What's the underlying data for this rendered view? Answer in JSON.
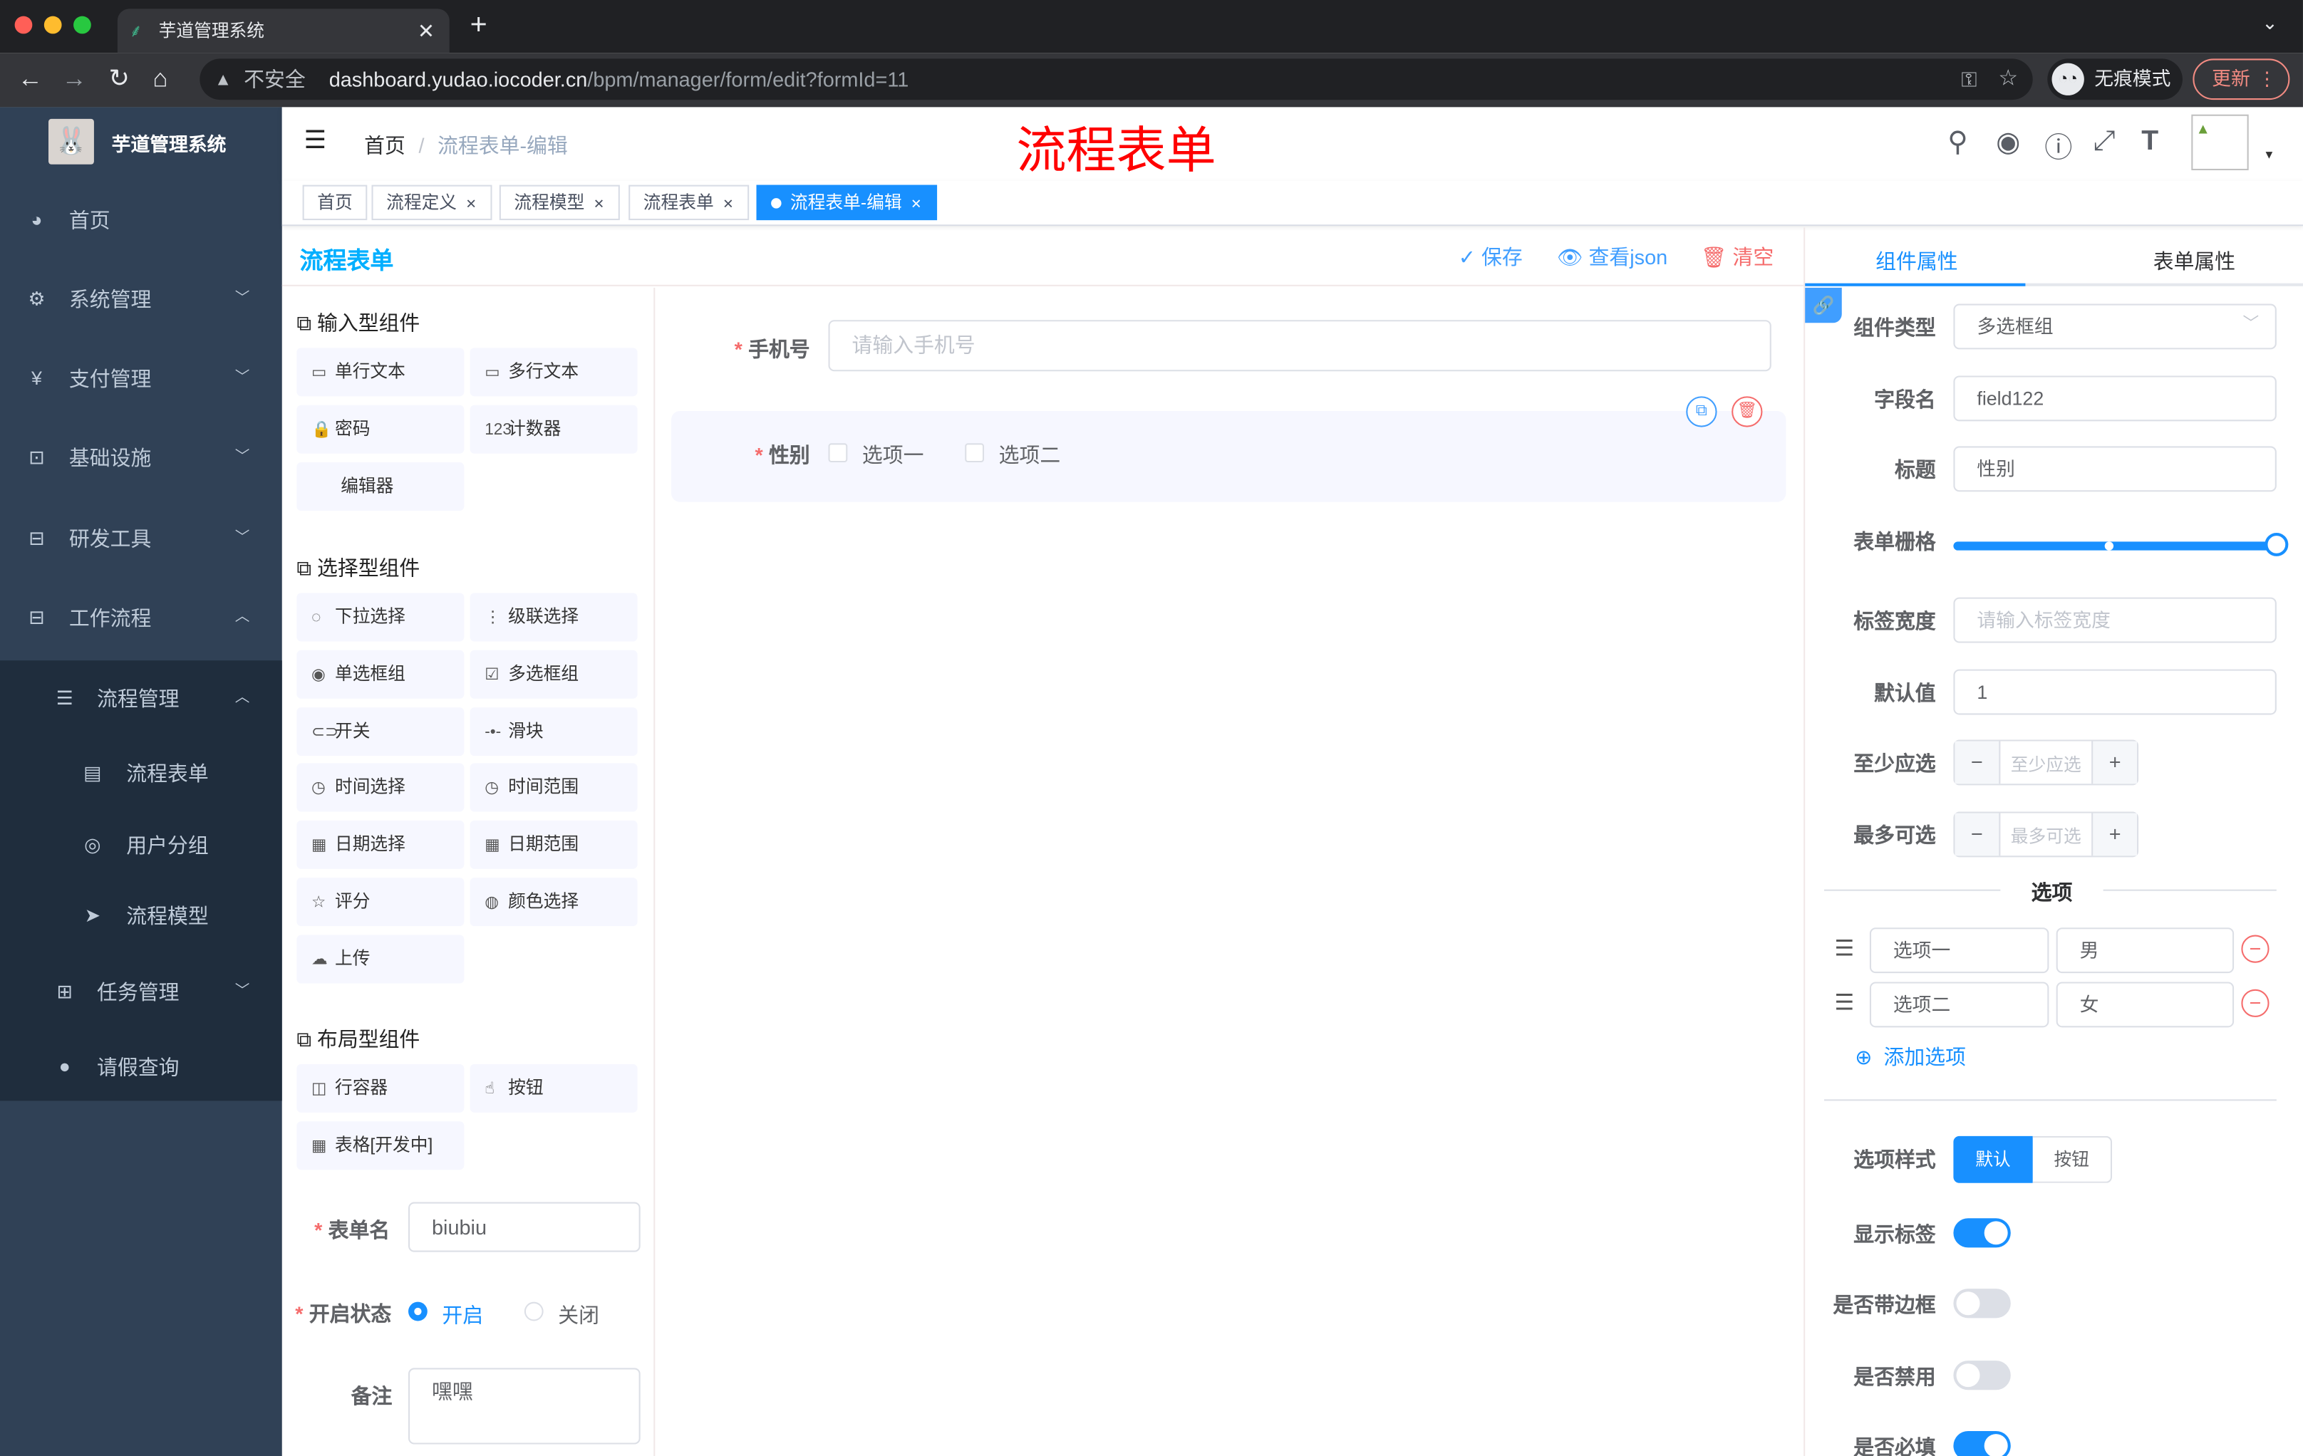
{
  "browser": {
    "tab_title": "芋道管理系统",
    "security": "不安全",
    "url_host": "dashboard.yudao.iocoder.cn",
    "url_path": "/bpm/manager/form/edit?formId=11",
    "incognito": "无痕模式",
    "update": "更新"
  },
  "sidebar": {
    "title": "芋道管理系统",
    "items": [
      {
        "label": "首页",
        "icon": "dashboard-icon"
      },
      {
        "label": "系统管理",
        "icon": "gear-icon"
      },
      {
        "label": "支付管理",
        "icon": "yen-icon"
      },
      {
        "label": "基础设施",
        "icon": "monitor-icon"
      },
      {
        "label": "研发工具",
        "icon": "toolbox-icon"
      },
      {
        "label": "工作流程",
        "icon": "toolbox-icon"
      },
      {
        "label": "流程管理",
        "icon": "list-icon"
      },
      {
        "label": "流程表单",
        "icon": "form-icon"
      },
      {
        "label": "用户分组",
        "icon": "group-icon"
      },
      {
        "label": "流程模型",
        "icon": "send-icon"
      },
      {
        "label": "任务管理",
        "icon": "tree-icon"
      },
      {
        "label": "请假查询",
        "icon": "user-icon"
      }
    ]
  },
  "navbar": {
    "breadcrumb": [
      "首页",
      "流程表单-编辑"
    ],
    "overlay_title": "流程表单"
  },
  "tags": [
    {
      "label": "首页"
    },
    {
      "label": "流程定义"
    },
    {
      "label": "流程模型"
    },
    {
      "label": "流程表单"
    },
    {
      "label": "流程表单-编辑"
    }
  ],
  "editor": {
    "title": "流程表单",
    "save": "保存",
    "view_json": "查看json",
    "clear": "清空"
  },
  "components": {
    "input_section": "输入型组件",
    "input": [
      {
        "label": "单行文本",
        "icon": "▭"
      },
      {
        "label": "多行文本",
        "icon": "▭"
      },
      {
        "label": "密码",
        "icon": "🔒"
      },
      {
        "label": "计数器",
        "icon": "123"
      },
      {
        "label": "编辑器",
        "icon": ""
      }
    ],
    "select_section": "选择型组件",
    "select": [
      {
        "label": "下拉选择",
        "icon": "◌"
      },
      {
        "label": "级联选择",
        "icon": "⋮"
      },
      {
        "label": "单选框组",
        "icon": "◉"
      },
      {
        "label": "多选框组",
        "icon": "☑"
      },
      {
        "label": "开关",
        "icon": "⊂⊃"
      },
      {
        "label": "滑块",
        "icon": "-•-"
      },
      {
        "label": "时间选择",
        "icon": "◷"
      },
      {
        "label": "时间范围",
        "icon": "◷"
      },
      {
        "label": "日期选择",
        "icon": "▦"
      },
      {
        "label": "日期范围",
        "icon": "▦"
      },
      {
        "label": "评分",
        "icon": "☆"
      },
      {
        "label": "颜色选择",
        "icon": "◍"
      },
      {
        "label": "上传",
        "icon": "☁"
      }
    ],
    "layout_section": "布局型组件",
    "layout": [
      {
        "label": "行容器",
        "icon": "◫"
      },
      {
        "label": "按钮",
        "icon": "☝"
      },
      {
        "label": "表格[开发中]",
        "icon": "▦"
      }
    ]
  },
  "form_meta": {
    "name_label": "表单名",
    "name_value": "biubiu",
    "status_label": "开启状态",
    "status_on": "开启",
    "status_off": "关闭",
    "status_value": "开启",
    "remark_label": "备注",
    "remark_value": "嘿嘿"
  },
  "canvas": {
    "phone_label": "手机号",
    "phone_placeholder": "请输入手机号",
    "gender_label": "性别",
    "gender_options": [
      "选项一",
      "选项二"
    ]
  },
  "props": {
    "tab_component": "组件属性",
    "tab_form": "表单属性",
    "type_label": "组件类型",
    "type_value": "多选框组",
    "field_label": "字段名",
    "field_value": "field122",
    "title_label": "标题",
    "title_value": "性别",
    "span_label": "表单栅格",
    "span_value": 24,
    "label_width_label": "标签宽度",
    "label_width_placeholder": "请输入标签宽度",
    "default_label": "默认值",
    "default_value": "1",
    "min_label": "至少应选",
    "min_placeholder": "至少应选",
    "max_label": "最多可选",
    "max_placeholder": "最多可选",
    "options_divider": "选项",
    "options": [
      {
        "label": "选项一",
        "value": "男"
      },
      {
        "label": "选项二",
        "value": "女"
      }
    ],
    "add_option": "添加选项",
    "style_label": "选项样式",
    "style_default": "默认",
    "style_button": "按钮",
    "show_label": "显示标签",
    "show_label_on": true,
    "border_label": "是否带边框",
    "border_on": false,
    "disabled_label": "是否禁用",
    "disabled_on": false,
    "required_label": "是否必填",
    "required_on": true
  },
  "colors": {
    "primary": "#1890ff",
    "sidebar": "#304156",
    "danger": "#f56c6c",
    "title_red": "#ff0000"
  }
}
